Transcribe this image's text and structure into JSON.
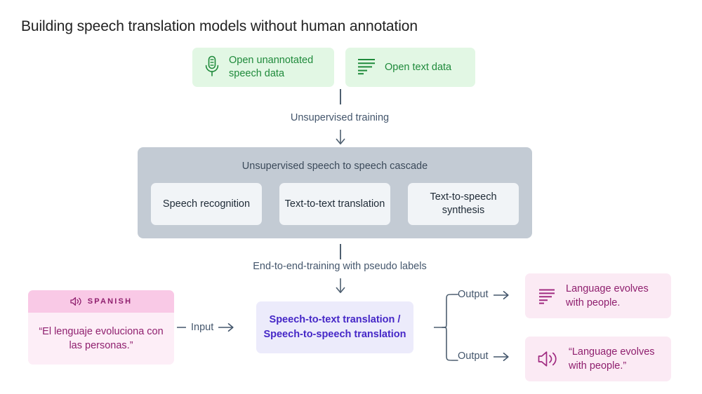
{
  "title": "Building speech translation models without human annotation",
  "sources": [
    {
      "icon": "microphone-icon",
      "label": "Open unannotated speech data"
    },
    {
      "icon": "text-lines-icon",
      "label": "Open text data"
    }
  ],
  "flow": {
    "unsupervised_training_label": "Unsupervised training",
    "end_to_end_training_label": "End-to-end-training with pseudo labels"
  },
  "cascade": {
    "title": "Unsupervised speech to speech cascade",
    "cards": [
      "Speech recognition",
      "Text-to-text translation",
      "Text-to-speech synthesis"
    ]
  },
  "input": {
    "language": "SPANISH",
    "icon": "speaker-icon",
    "text": "“El lenguaje evoluciona con las personas.”",
    "connector_label": "Input"
  },
  "model": {
    "label": "Speech-to-text translation / Speech-to-speech translation"
  },
  "outputs": [
    {
      "connector_label": "Output",
      "icon": "text-lines-icon",
      "text": "Language evolves with people."
    },
    {
      "connector_label": "Output",
      "icon": "speaker-icon",
      "text": "“Language evolves with people.”"
    }
  ],
  "colors": {
    "background": "#ffffff",
    "title_text": "#222222",
    "source_box": "#e2f7e4",
    "source_text": "#1f8a3b",
    "cascade_panel": "#c3cbd4",
    "cascade_card": "#f1f4f7",
    "cascade_text": "#1e2a36",
    "connector": "#44566c",
    "input_header": "#f9c9e6",
    "input_body": "#fdeef7",
    "pink_text": "#8f1f6e",
    "model_box": "#ecebfb",
    "model_text": "#4527c7",
    "output_box": "#fbeaf4"
  }
}
